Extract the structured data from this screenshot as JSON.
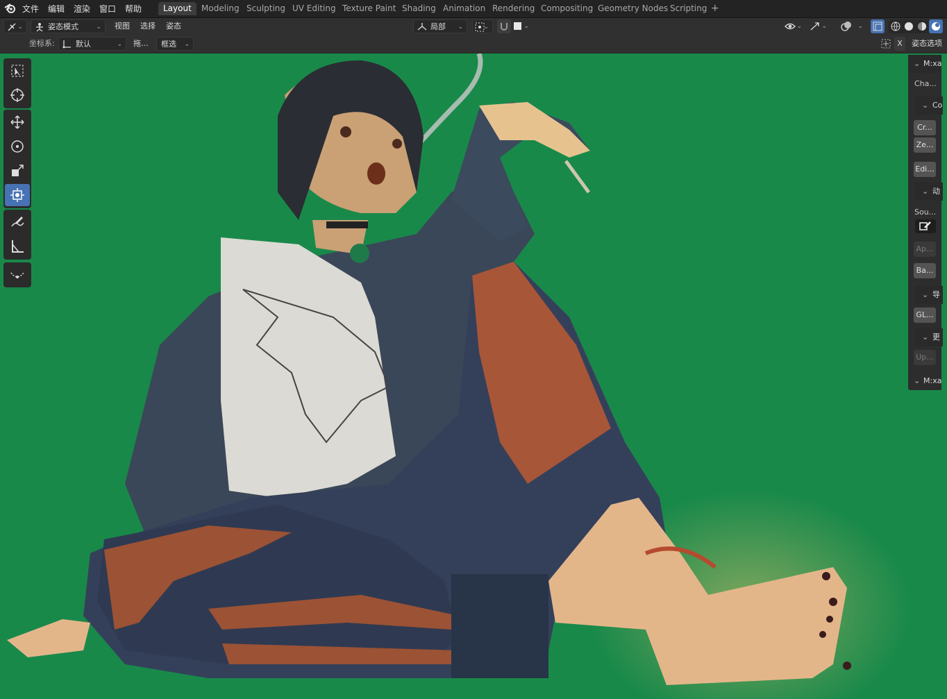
{
  "menu": {
    "items": [
      "文件",
      "编辑",
      "渲染",
      "窗口",
      "帮助"
    ]
  },
  "workspaces": {
    "tabs": [
      "Layout",
      "Modeling",
      "Sculpting",
      "UV Editing",
      "Texture Paint",
      "Shading",
      "Animation",
      "Rendering",
      "Compositing",
      "Geometry Nodes",
      "Scripting"
    ],
    "active": "Layout",
    "add_symbol": "+"
  },
  "header": {
    "mode": "姿态模式",
    "menus": [
      "视图",
      "选择",
      "姿态"
    ],
    "pivot": "局部"
  },
  "header2": {
    "coord_label": "坐标系:",
    "coord_value": "默认",
    "drag_label": "拖...",
    "select_mode": "框选",
    "close_symbol": "X",
    "pose_options": "姿态选项"
  },
  "sidebar": {
    "panel1_title": "M:xa",
    "cha_text": "Cha...",
    "co_title": "Co",
    "btn_cr": "Cr...",
    "btn_ze": "Ze...",
    "btn_edi": "Edi...",
    "dong_title": "动",
    "sou_text": "Sou...",
    "btn_ap": "Ap...",
    "btn_ba": "Ba...",
    "dao_title": "导",
    "btn_gl": "GL...",
    "geng_title": "更",
    "btn_up": "Up...",
    "panel2_title": "M:xa"
  },
  "colors": {
    "viewport_bg": "#19894a",
    "active_accent": "#4772b3",
    "topbar": "#232323"
  }
}
